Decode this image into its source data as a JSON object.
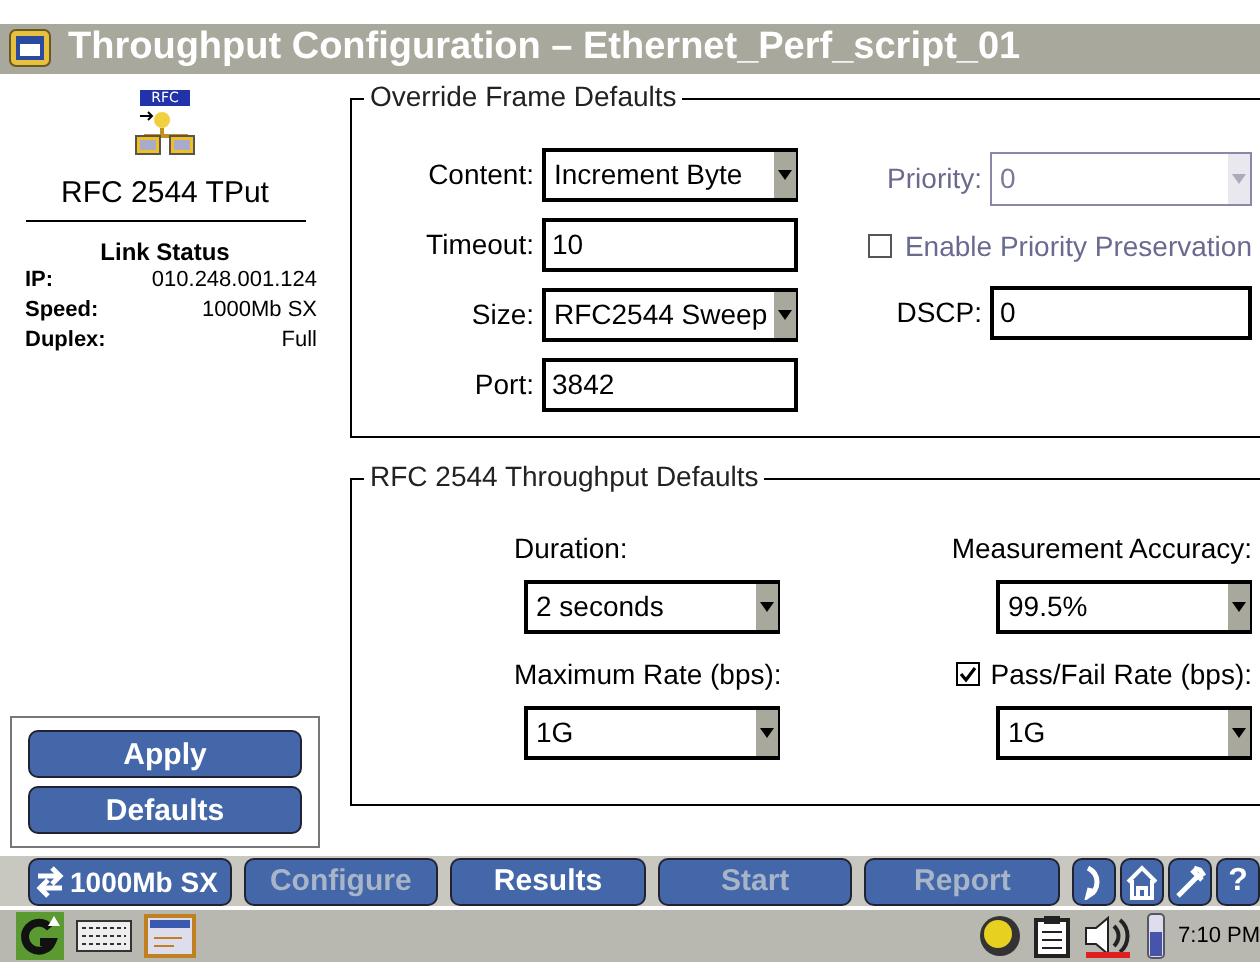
{
  "window": {
    "title": "Throughput Configuration – Ethernet_Perf_script_01"
  },
  "sidebar": {
    "badge": "RFC",
    "test_name": "RFC 2544 TPut",
    "link_status_title": "Link Status",
    "link_status": [
      {
        "label": "IP:",
        "value": "010.248.001.124"
      },
      {
        "label": "Speed:",
        "value": "1000Mb SX"
      },
      {
        "label": "Duplex:",
        "value": "Full"
      }
    ],
    "buttons": [
      {
        "label": "Apply"
      },
      {
        "label": "Defaults"
      }
    ]
  },
  "override_frame": {
    "title": "Override Frame Defaults",
    "left_fields": [
      {
        "kind": "select",
        "label": "Content:",
        "value": "Increment Byte"
      },
      {
        "kind": "input",
        "label": "Timeout:",
        "value": "10"
      },
      {
        "kind": "select",
        "label": "Size:",
        "value": "RFC2544 Sweep"
      },
      {
        "kind": "input",
        "label": "Port:",
        "value": "3842"
      }
    ],
    "priority": {
      "label": "Priority:",
      "value": "0",
      "disabled": true
    },
    "priority_preservation": {
      "label": "Enable Priority Preservation",
      "checked": false,
      "disabled": true
    },
    "dscp": {
      "label": "DSCP:",
      "value": "0"
    }
  },
  "throughput_defaults": {
    "title": "RFC 2544 Throughput Defaults",
    "fields": [
      {
        "label": "Duration:",
        "value": "2 seconds"
      },
      {
        "label": "Measurement Accuracy:",
        "value": "99.5%"
      },
      {
        "label": "Maximum Rate (bps):",
        "value": "1G"
      },
      {
        "label": "Pass/Fail Rate (bps):",
        "value": "1G",
        "checkbox": true,
        "checked": true
      }
    ]
  },
  "nav_bar": {
    "port": "1000Mb SX",
    "buttons": [
      {
        "label": "Configure",
        "disabled": true
      },
      {
        "label": "Results",
        "disabled": false
      },
      {
        "label": "Start",
        "disabled": true
      },
      {
        "label": "Report",
        "disabled": true
      }
    ],
    "help": "?"
  },
  "taskbar": {
    "time": "7:10 PM"
  }
}
